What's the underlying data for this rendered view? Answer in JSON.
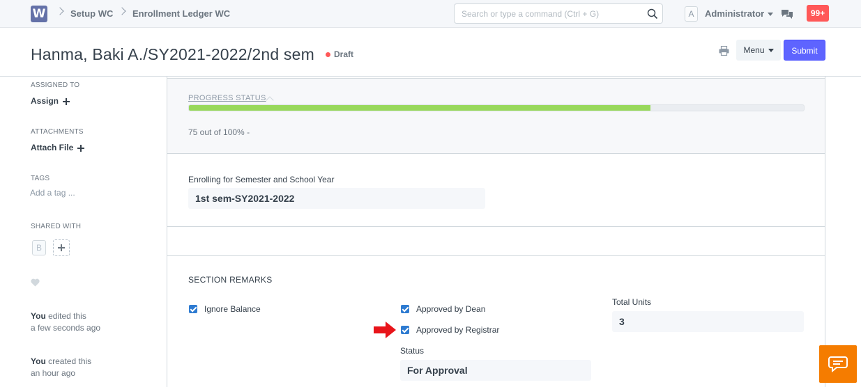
{
  "navbar": {
    "logo_letter": "W",
    "breadcrumbs": [
      "Setup WC",
      "Enrollment Ledger WC"
    ],
    "search_placeholder": "Search or type a command (Ctrl + G)",
    "avatar_letter": "A",
    "user_name": "Administrator",
    "notification_count": "99+"
  },
  "page_head": {
    "title": "Hanma, Baki A./SY2021-2022/2nd sem",
    "status": "Draft",
    "status_color": "#ff5858",
    "menu_label": "Menu",
    "submit_label": "Submit",
    "accent_color": "#5e64ff"
  },
  "sidebar": {
    "assigned_to_label": "ASSIGNED TO",
    "assign_action": "Assign",
    "attachments_label": "ATTACHMENTS",
    "attach_action": "Attach File",
    "tags_label": "TAGS",
    "add_tag": "Add a tag ...",
    "shared_with_label": "SHARED WITH",
    "shared_avatar": "B",
    "timeline": [
      {
        "user": "You",
        "action": "edited this",
        "time": "a few seconds ago"
      },
      {
        "user": "You",
        "action": "created this",
        "time": "an hour ago"
      }
    ]
  },
  "progress": {
    "heading": "PROGRESS STATUS",
    "percent": 75,
    "text": "75 out of 100% -",
    "bar_color": "#98d85b"
  },
  "enrollment": {
    "semester_label": "Enrolling for Semester and School Year",
    "semester_value": "1st sem-SY2021-2022"
  },
  "remarks": {
    "title": "SECTION REMARKS",
    "ignore_balance_label": "Ignore Balance",
    "ignore_balance_checked": true,
    "approved_dean_label": "Approved by Dean",
    "approved_dean_checked": true,
    "approved_registrar_label": "Approved by Registrar",
    "approved_registrar_checked": true,
    "status_label": "Status",
    "status_value": "For Approval",
    "total_units_label": "Total Units",
    "total_units_value": "3"
  },
  "icons": {
    "search": "search-icon",
    "chat": "chat-bubbles-icon",
    "print": "printer-icon",
    "heart": "heart-icon",
    "arrow": "red-arrow-pointer",
    "support": "support-chat-icon"
  }
}
